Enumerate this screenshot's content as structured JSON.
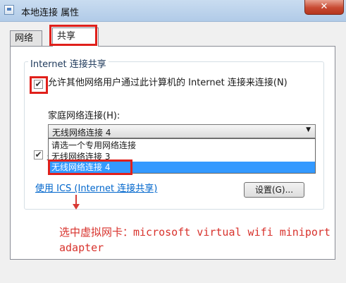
{
  "window": {
    "title": "本地连接 属性",
    "close_glyph": "✕"
  },
  "tabs": [
    {
      "label": "网络",
      "selected": false
    },
    {
      "label": "共享",
      "selected": true
    }
  ],
  "sharing": {
    "group_title": "Internet 连接共享",
    "allow_checkbox": {
      "label": "允许其他网络用户通过此计算机的 Internet 连接来连接(N)",
      "checked": true,
      "glyph": "✔"
    },
    "home_network_label": "家庭网络连接(H):",
    "combo": {
      "value": "无线网络连接 4",
      "arrow_glyph": "▼",
      "options": [
        "请选一个专用网络连接",
        "无线网络连接 3",
        "无线网络连接 4"
      ],
      "highlighted_index": 2
    },
    "second_checkbox": {
      "checked": true,
      "glyph": "✔",
      "label_fragment": "允"
    },
    "ics_link": "使用 ICS (Internet 连接共享)",
    "settings_button": "设置(G)..."
  },
  "annotation": {
    "text": "选中虚拟网卡：microsoft virtual wifi miniport adapter",
    "color": "#d8322c"
  },
  "colors": {
    "highlight": "#e0201b",
    "selection": "#3399ff",
    "link": "#0066cc"
  }
}
